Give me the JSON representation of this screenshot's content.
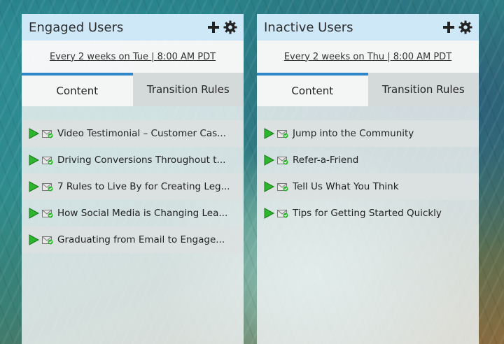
{
  "panels": [
    {
      "title": "Engaged Users",
      "schedule": "Every 2 weeks on Tue | 8:00 AM PDT",
      "tabs": [
        "Content",
        "Transition Rules"
      ],
      "items": [
        "Video Testimonial – Customer Cas...",
        "Driving Conversions Throughout t...",
        "7 Rules to Live By for Creating Leg...",
        "How Social Media is Changing Lea...",
        "Graduating from Email to Engage..."
      ]
    },
    {
      "title": "Inactive Users",
      "schedule": "Every 2 weeks on Thu | 8:00 AM PDT",
      "tabs": [
        "Content",
        "Transition Rules"
      ],
      "items": [
        "Jump into the Community",
        "Refer-a-Friend",
        "Tell Us What You Think",
        "Tips for Getting Started Quickly"
      ]
    }
  ],
  "icons": {
    "add": "plus-icon",
    "settings": "gear-icon",
    "play": "play-icon",
    "content_type": "email-icon"
  },
  "colors": {
    "active_tab_accent": "#2f86c8",
    "play_green": "#2db52d"
  }
}
